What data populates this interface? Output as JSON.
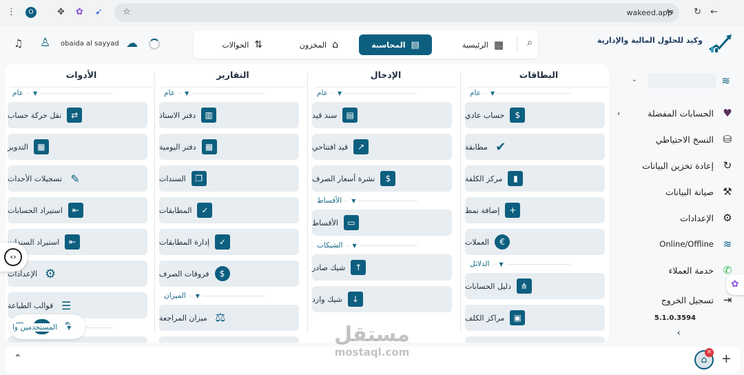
{
  "browser": {
    "url": "wakeed.app",
    "profile_initial": "O"
  },
  "app": {
    "brand_name": "وكيد للحلول المالية والإدارية",
    "nav_tabs": [
      {
        "label": "الرئيسية",
        "icon": "grid-icon",
        "active": false
      },
      {
        "label": "المحاسبة",
        "icon": "calculator-icon",
        "active": true
      },
      {
        "label": "المخزون",
        "icon": "warehouse-icon",
        "active": false
      },
      {
        "label": "الحوالات",
        "icon": "transfer-arrows-icon",
        "active": false
      }
    ],
    "user_name": "obaida al sayyad",
    "version": "5.1.0.3594"
  },
  "sidebar": {
    "items": [
      {
        "label": "الحسابات المفضلة",
        "icon": "heart-icon"
      },
      {
        "label": "النسخ الاحتياطي",
        "icon": "database-icon"
      },
      {
        "label": "إعادة تخزين البيانات",
        "icon": "refresh-icon"
      },
      {
        "label": "صيانة البيانات",
        "icon": "wrench-icon"
      },
      {
        "label": "الإعدادات",
        "icon": "gear-icon"
      },
      {
        "label": "Online/Offline",
        "icon": "wifi-icon"
      },
      {
        "label": "خدمة العملاء",
        "icon": "whatsapp-icon"
      },
      {
        "label": "تسجيل الخروج",
        "icon": "logout-icon"
      }
    ]
  },
  "columns": [
    {
      "title": "البطاقات",
      "sections": [
        {
          "label": "عام",
          "items": [
            "حساب عادي",
            "مطابقة",
            "مركز الكلفة",
            "إضافة نمط",
            "العملات"
          ]
        },
        {
          "label": "الدلائل",
          "items": [
            "دليل الحسابات",
            "مراكز الكلف"
          ]
        }
      ]
    },
    {
      "title": "الإدخال",
      "sections": [
        {
          "label": "عام",
          "items": [
            "سند قيد",
            "قيد افتتاحي",
            "نشرة أسعار الصرف"
          ]
        },
        {
          "label": "الأقساط",
          "items": [
            "الأقساط"
          ]
        },
        {
          "label": "الشيكات",
          "items": [
            "شيك صادر",
            "شيك وارد"
          ]
        }
      ]
    },
    {
      "title": "التقارير",
      "sections": [
        {
          "label": "عام",
          "items": [
            "دفتر الاستاذ",
            "دفتر اليومية",
            "السندات",
            "المطابقات",
            "إدارة المطابقات",
            "فروقات الصرف"
          ]
        },
        {
          "label": "الميزان",
          "items": [
            "ميزان المراجعة"
          ]
        }
      ]
    },
    {
      "title": "الأدوات",
      "sections": [
        {
          "label": "عام",
          "items": [
            "نقل حركة حساب",
            "التدوير",
            "تسجيلات الأحداث",
            "استيراد الحسابات",
            "استيراد السندات",
            "الإعدادات",
            "قوالب الطباعة"
          ]
        },
        {
          "label": "المستخدمين وا",
          "items": []
        }
      ]
    }
  ],
  "watermark": {
    "text": "مستقل",
    "sub": "mostaql.com"
  },
  "colors": {
    "accent": "#0d5f7f",
    "card_bg": "#e8edf1",
    "section": "#1b6c8a"
  }
}
